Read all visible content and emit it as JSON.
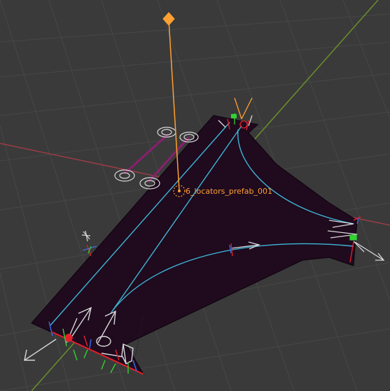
{
  "viewport": {
    "selected_object_label": "6_locators_prefab_001"
  },
  "colors": {
    "background": "#3a3a3a",
    "grid_line": "#454545",
    "x_axis": "#9c3b46",
    "y_axis": "#6b8f2b",
    "mesh_face": "#1f0a1e",
    "mesh_edge": "#0d020c",
    "lane_curve": "#3fb6d6",
    "selection_orange": "#ffa033",
    "gizmo_white": "#d8d8d8",
    "axis_red": "#e5202b",
    "axis_green": "#32d232",
    "axis_blue": "#3a6ff0"
  }
}
